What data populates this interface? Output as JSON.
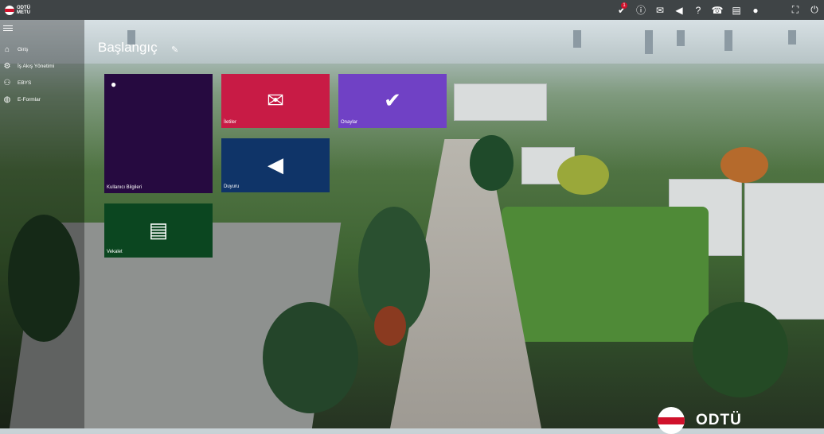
{
  "app": {
    "logo_text": "ODTÜ\nMETU"
  },
  "topbar": {
    "icons": [
      "approval-icon",
      "info-icon",
      "message-icon",
      "megaphone-icon",
      "help-icon",
      "phone-icon",
      "document-icon",
      "user-icon",
      "fullscreen-icon",
      "power-icon"
    ],
    "glyphs": [
      "✔",
      "ⓘ",
      "✉",
      "◀",
      "?",
      "☎",
      "▤",
      "●",
      "⛶",
      "⏻"
    ],
    "approval_badge": "1"
  },
  "sidebar": {
    "items": [
      {
        "label": "Giriş",
        "icon": "home-icon",
        "glyph": "⌂"
      },
      {
        "label": "İş Akış Yönetimi",
        "icon": "workflow-icon",
        "glyph": "⚙"
      },
      {
        "label": "EBYS",
        "icon": "people-icon",
        "glyph": "⚇"
      },
      {
        "label": "E-Formlar",
        "icon": "globe-icon",
        "glyph": "◍"
      }
    ]
  },
  "page": {
    "title": "Başlangıç"
  },
  "tiles": {
    "user_info": {
      "label": "Kullanıcı Bilgileri",
      "color": "#260a40"
    },
    "messages": {
      "label": "İletiler",
      "color": "#c81b45"
    },
    "approvals": {
      "label": "Onaylar",
      "color": "#7041c5"
    },
    "announcements": {
      "label": "Duyuru",
      "color": "#0f3468"
    },
    "proxy": {
      "label": "Vekalet",
      "color": "#0b4620"
    }
  },
  "footer": {
    "brand": "ODTÜ"
  }
}
